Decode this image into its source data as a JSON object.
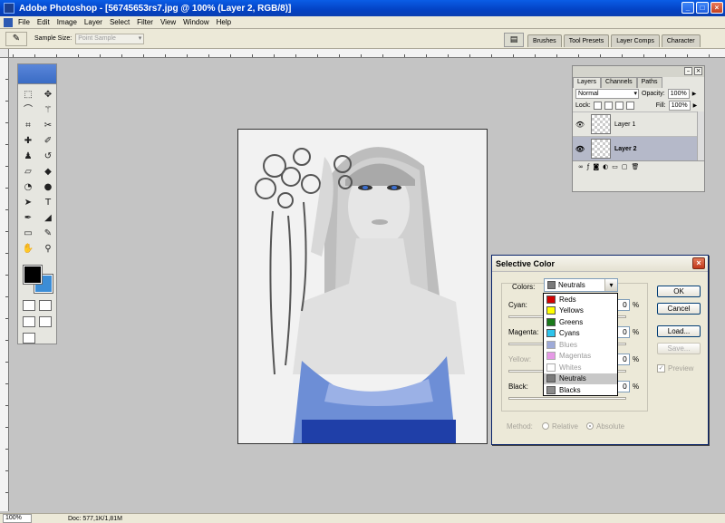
{
  "window": {
    "title": "Adobe Photoshop - [56745653rs7.jpg @ 100% (Layer 2, RGB/8)]",
    "min": "_",
    "max": "□",
    "close": "×"
  },
  "menu": [
    "File",
    "Edit",
    "Image",
    "Layer",
    "Select",
    "Filter",
    "View",
    "Window",
    "Help"
  ],
  "options": {
    "sample_size_label": "Sample Size:",
    "sample_size_value": "Point Sample"
  },
  "palette_well": [
    "Brushes",
    "Tool Presets",
    "Layer Comps",
    "Character"
  ],
  "layers": {
    "tabs": [
      "Layers",
      "Channels",
      "Paths"
    ],
    "blend_mode": "Normal",
    "opacity_label": "Opacity:",
    "opacity": "100%",
    "lock_label": "Lock:",
    "fill_label": "Fill:",
    "fill": "100%",
    "items": [
      "Layer 1",
      "Layer 2"
    ]
  },
  "dialog": {
    "title": "Selective Color",
    "colors_label": "Colors:",
    "colors_value": "Neutrals",
    "cyan_label": "Cyan:",
    "magenta_label": "Magenta:",
    "yellow_label": "Yellow:",
    "black_label": "Black:",
    "values": {
      "cyan": "0",
      "magenta": "0",
      "yellow": "0",
      "black": "0"
    },
    "pct": "%",
    "ok": "OK",
    "cancel": "Cancel",
    "load": "Load...",
    "save": "Save...",
    "preview_label": "Preview",
    "method_label": "Method:",
    "relative": "Relative",
    "absolute": "Absolute"
  },
  "colors_dropdown": [
    {
      "label": "Reds",
      "color": "#d40000"
    },
    {
      "label": "Yellows",
      "color": "#ffff00"
    },
    {
      "label": "Greens",
      "color": "#1a7a1a"
    },
    {
      "label": "Cyans",
      "color": "#2ec4ec"
    },
    {
      "label": "Blues",
      "color": "#9eaad8"
    },
    {
      "label": "Magentas",
      "color": "#e69ae6"
    },
    {
      "label": "Whites",
      "color": "#ffffff"
    },
    {
      "label": "Neutrals",
      "color": "#7a7a7a"
    },
    {
      "label": "Blacks",
      "color": "#8a8a8a"
    }
  ],
  "status": {
    "zoom": "100%",
    "doc": "Doc: 577,1K/1,81M"
  }
}
